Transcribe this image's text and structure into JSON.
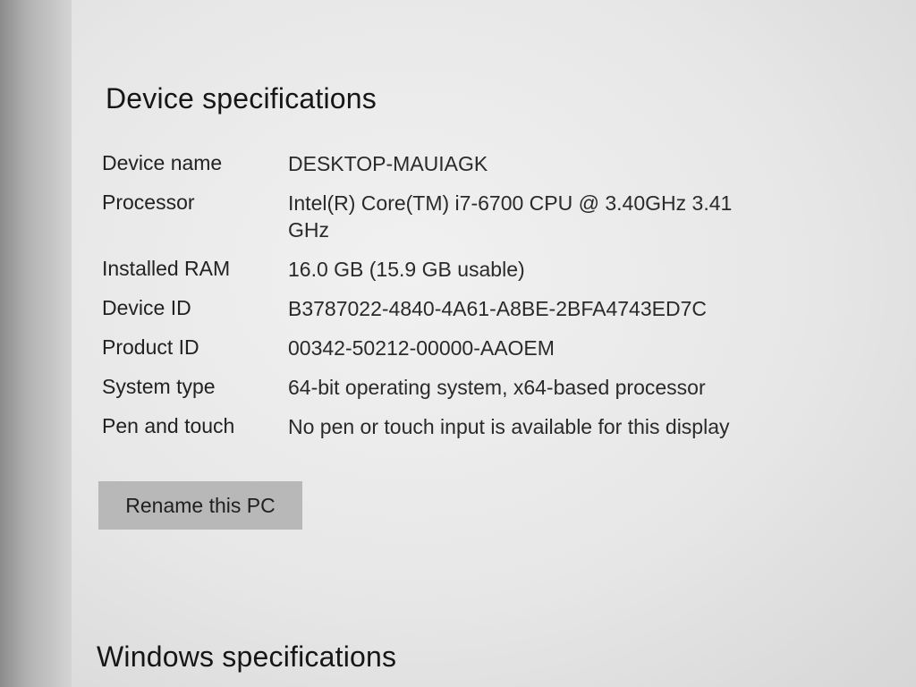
{
  "device_section": {
    "title": "Device specifications",
    "specs": [
      {
        "label": "Device name",
        "value": "DESKTOP-MAUIAGK"
      },
      {
        "label": "Processor",
        "value": "Intel(R) Core(TM) i7-6700 CPU @ 3.40GHz   3.41 GHz"
      },
      {
        "label": "Installed RAM",
        "value": "16.0 GB (15.9 GB usable)"
      },
      {
        "label": "Device ID",
        "value": "B3787022-4840-4A61-A8BE-2BFA4743ED7C"
      },
      {
        "label": "Product ID",
        "value": "00342-50212-00000-AAOEM"
      },
      {
        "label": "System type",
        "value": "64-bit operating system, x64-based processor"
      },
      {
        "label": "Pen and touch",
        "value": "No pen or touch input is available for this display"
      }
    ],
    "rename_button": "Rename this PC"
  },
  "windows_section": {
    "title": "Windows specifications"
  }
}
